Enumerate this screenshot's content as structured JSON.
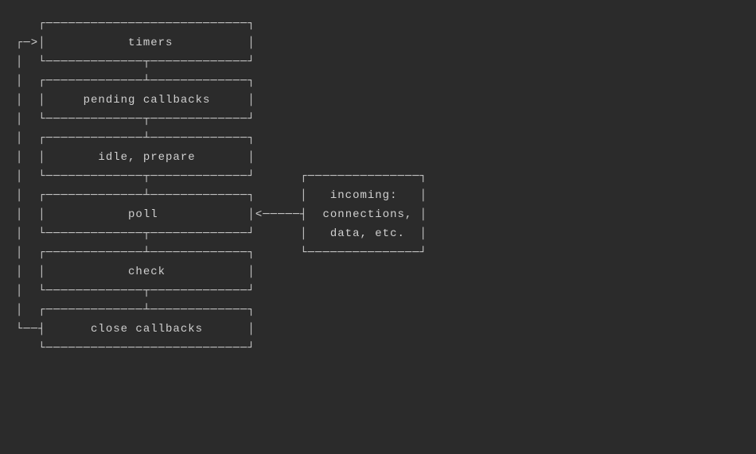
{
  "diagram": {
    "type": "event-loop-phases",
    "entry_arrow": "─>",
    "phase_arrow": "<─────",
    "phases": [
      {
        "id": "timers",
        "label": "timers"
      },
      {
        "id": "pending-callbacks",
        "label": "pending callbacks"
      },
      {
        "id": "idle-prepare",
        "label": "idle, prepare"
      },
      {
        "id": "poll",
        "label": "poll"
      },
      {
        "id": "check",
        "label": "check"
      },
      {
        "id": "close-callbacks",
        "label": "close callbacks"
      }
    ],
    "sidebox": {
      "lines": [
        "incoming:",
        "connections,",
        "data, etc."
      ]
    }
  }
}
